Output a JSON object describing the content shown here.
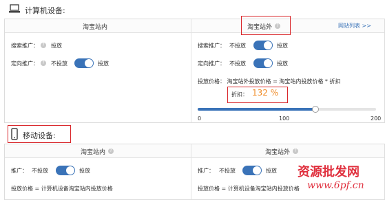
{
  "computer": {
    "icon": "laptop-icon",
    "title": "计算机设备:",
    "col_in": {
      "title": "淘宝站内"
    },
    "col_out": {
      "title": "淘宝站外",
      "help": "?",
      "link": "网站列表 >>"
    },
    "in_rows": [
      {
        "label": "搜索推广：",
        "help": "?",
        "value": "投放"
      },
      {
        "label": "定向推广：",
        "help": "?",
        "off": "不投放",
        "on": "投放",
        "toggle_on": true
      }
    ],
    "out_rows": [
      {
        "label": "搜索推广：",
        "off": "不投放",
        "on": "投放",
        "toggle_on": true
      },
      {
        "label": "定向推广：",
        "off": "不投放",
        "on": "投放",
        "toggle_on": true
      }
    ],
    "price_formula": "投放价格： 淘宝站外投放价格 = 淘宝站内投放价格 * 折扣",
    "discount_label": "折扣：",
    "discount_value": "132 %",
    "slider": {
      "min_label": "0",
      "mid_label": "100",
      "max_label": "200",
      "value": 132,
      "max": 200
    }
  },
  "mobile": {
    "icon": "mobile-phone-icon",
    "title": "移动设备:",
    "col_in": {
      "title": "淘宝站内",
      "help": "?"
    },
    "col_out": {
      "title": "淘宝站外",
      "help": "?"
    },
    "in_row": {
      "label": "推广：",
      "off": "不投放",
      "on": "投放",
      "toggle_on": true
    },
    "out_row": {
      "label": "推广：",
      "off": "不投放",
      "on": "投放",
      "toggle_on": true
    },
    "in_price": "投放价格 = 计算机设备淘宝站内投放价格",
    "out_price": "投放价格 = 计算机设备淘宝站内投放价格"
  },
  "watermark": {
    "text1": "资源批发网",
    "text2": "www.6pf.cn"
  },
  "colors": {
    "accent": "#3a73b8",
    "highlight_box": "#d9262a",
    "discount": "#f08c28"
  }
}
